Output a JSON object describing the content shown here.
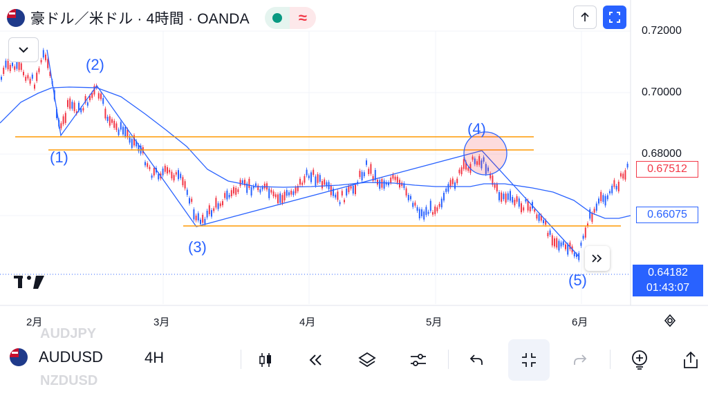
{
  "header": {
    "title": "豪ドル／米ドル · 4時間 · OANDA",
    "market_status": "open",
    "alt_mark": "≈"
  },
  "colors": {
    "up": "#2962ff",
    "down": "#f23645",
    "line": "#2962ff",
    "level": "#ff9800",
    "accent": "#2962ff"
  },
  "price_axis": {
    "labels": [
      "0.72000",
      "0.70000",
      "0.68000"
    ],
    "current_price": "0.67512",
    "ma_value": "0.66075",
    "last_price": "0.64182",
    "countdown": "01:43:07"
  },
  "time_axis": {
    "labels": [
      "2月",
      "3月",
      "4月",
      "5月",
      "6月"
    ]
  },
  "annotations": {
    "wave_labels": [
      "(1)",
      "(2)",
      "(3)",
      "(4)",
      "(5)"
    ]
  },
  "chart_data": {
    "type": "candlestick",
    "symbol": "AUDUSD",
    "timeframe": "4H",
    "ylim": [
      0.633,
      0.725
    ],
    "elliott_wave_points": [
      {
        "label": "(1)",
        "x": "2月 early",
        "y": 0.686
      },
      {
        "label": "(2)",
        "x": "2月 mid",
        "y": 0.7025
      },
      {
        "label": "(3)",
        "x": "3月 early",
        "y": 0.6565
      },
      {
        "label": "(4)",
        "x": "5月 early",
        "y": 0.6815
      },
      {
        "label": "(5)",
        "x": "6月 early",
        "y": 0.646
      }
    ],
    "horizontal_levels": [
      0.686,
      0.6815,
      0.6565
    ],
    "moving_average_last": 0.66075,
    "last_price": 0.67512
  },
  "bottom_toolbar": {
    "symbol": "AUDUSD",
    "ghost_above": "AUDJPY",
    "ghost_below": "NZDUSD",
    "timeframe": "4H"
  }
}
